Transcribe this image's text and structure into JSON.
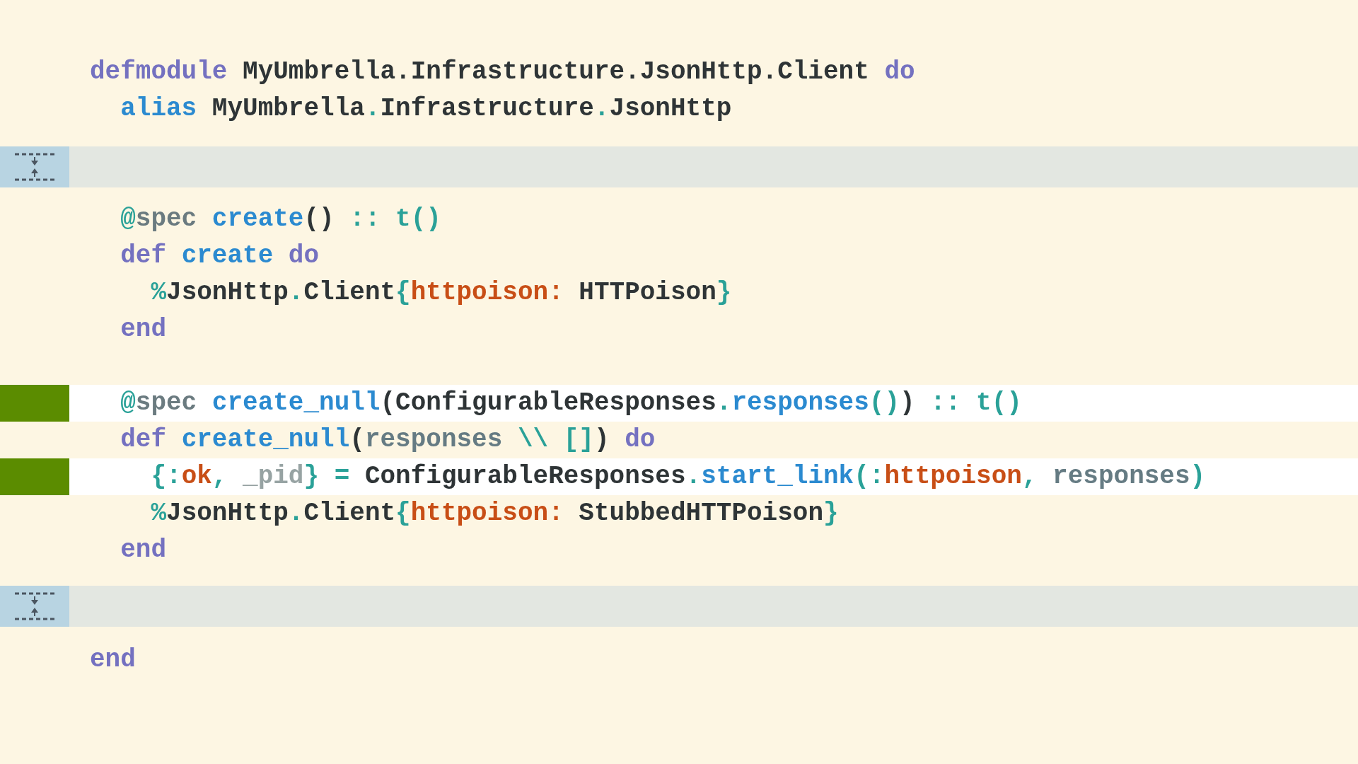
{
  "lines": [
    {
      "kind": "code",
      "added": false,
      "tokens": [
        {
          "kind": "keyword",
          "text": "defmodule"
        },
        {
          "kind": "module",
          "text": " MyUmbrella.Infrastructure.JsonHttp.Client"
        },
        {
          "kind": "keyword",
          "text": " do"
        }
      ]
    },
    {
      "kind": "code",
      "added": false,
      "tokens": [
        {
          "kind": "name",
          "text": "  alias"
        },
        {
          "kind": "module",
          "text": " MyUmbrella"
        },
        {
          "kind": "op",
          "text": "."
        },
        {
          "kind": "module",
          "text": "Infrastructure"
        },
        {
          "kind": "op",
          "text": "."
        },
        {
          "kind": "module",
          "text": "JsonHttp"
        }
      ]
    },
    {
      "kind": "hunk"
    },
    {
      "kind": "code",
      "added": false,
      "tokens": [
        {
          "kind": "op",
          "text": "  @"
        },
        {
          "kind": "attr",
          "text": "spec"
        },
        {
          "kind": "name",
          "text": " create"
        },
        {
          "kind": "text",
          "text": "()"
        },
        {
          "kind": "op",
          "text": " :: t()"
        }
      ]
    },
    {
      "kind": "code",
      "added": false,
      "tokens": [
        {
          "kind": "keyword",
          "text": "  def"
        },
        {
          "kind": "name",
          "text": " create"
        },
        {
          "kind": "keyword",
          "text": " do"
        }
      ]
    },
    {
      "kind": "code",
      "added": false,
      "tokens": [
        {
          "kind": "op",
          "text": "    %"
        },
        {
          "kind": "module",
          "text": "JsonHttp"
        },
        {
          "kind": "op",
          "text": "."
        },
        {
          "kind": "module",
          "text": "Client"
        },
        {
          "kind": "op",
          "text": "{"
        },
        {
          "kind": "atom",
          "text": "httpoison:"
        },
        {
          "kind": "module",
          "text": " HTTPoison"
        },
        {
          "kind": "op",
          "text": "}"
        }
      ]
    },
    {
      "kind": "code",
      "added": false,
      "tokens": [
        {
          "kind": "keyword",
          "text": "  end"
        }
      ]
    },
    {
      "kind": "blank"
    },
    {
      "kind": "code",
      "added": true,
      "tokens": [
        {
          "kind": "op",
          "text": "  @"
        },
        {
          "kind": "attr",
          "text": "spec"
        },
        {
          "kind": "name",
          "text": " create_null"
        },
        {
          "kind": "text",
          "text": "("
        },
        {
          "kind": "module",
          "text": "ConfigurableResponses"
        },
        {
          "kind": "op",
          "text": "."
        },
        {
          "kind": "name",
          "text": "responses"
        },
        {
          "kind": "op",
          "text": "()"
        },
        {
          "kind": "text",
          "text": ")"
        },
        {
          "kind": "op",
          "text": " :: t()"
        }
      ]
    },
    {
      "kind": "code",
      "added": false,
      "tokens": [
        {
          "kind": "keyword",
          "text": "  def"
        },
        {
          "kind": "name",
          "text": " create_null"
        },
        {
          "kind": "text",
          "text": "("
        },
        {
          "kind": "var",
          "text": "responses"
        },
        {
          "kind": "op",
          "text": " \\\\ []"
        },
        {
          "kind": "text",
          "text": ")"
        },
        {
          "kind": "keyword",
          "text": " do"
        }
      ]
    },
    {
      "kind": "code",
      "added": true,
      "tokens": [
        {
          "kind": "op",
          "text": "    {:"
        },
        {
          "kind": "atom",
          "text": "ok"
        },
        {
          "kind": "op",
          "text": ", "
        },
        {
          "kind": "ignored",
          "text": "_pid"
        },
        {
          "kind": "op",
          "text": "} ="
        },
        {
          "kind": "module",
          "text": " ConfigurableResponses"
        },
        {
          "kind": "op",
          "text": "."
        },
        {
          "kind": "name",
          "text": "start_link"
        },
        {
          "kind": "op",
          "text": "(:"
        },
        {
          "kind": "atom",
          "text": "httpoison"
        },
        {
          "kind": "op",
          "text": ", "
        },
        {
          "kind": "var",
          "text": "responses"
        },
        {
          "kind": "op",
          "text": ")"
        }
      ]
    },
    {
      "kind": "code",
      "added": false,
      "tokens": [
        {
          "kind": "op",
          "text": "    %"
        },
        {
          "kind": "module",
          "text": "JsonHttp"
        },
        {
          "kind": "op",
          "text": "."
        },
        {
          "kind": "module",
          "text": "Client"
        },
        {
          "kind": "op",
          "text": "{"
        },
        {
          "kind": "atom",
          "text": "httpoison:"
        },
        {
          "kind": "module",
          "text": " StubbedHTTPoison"
        },
        {
          "kind": "op",
          "text": "}"
        }
      ]
    },
    {
      "kind": "code",
      "added": false,
      "tokens": [
        {
          "kind": "keyword",
          "text": "  end"
        }
      ]
    },
    {
      "kind": "hunk"
    },
    {
      "kind": "code",
      "added": false,
      "tokens": [
        {
          "kind": "keyword",
          "text": "end"
        }
      ]
    }
  ]
}
